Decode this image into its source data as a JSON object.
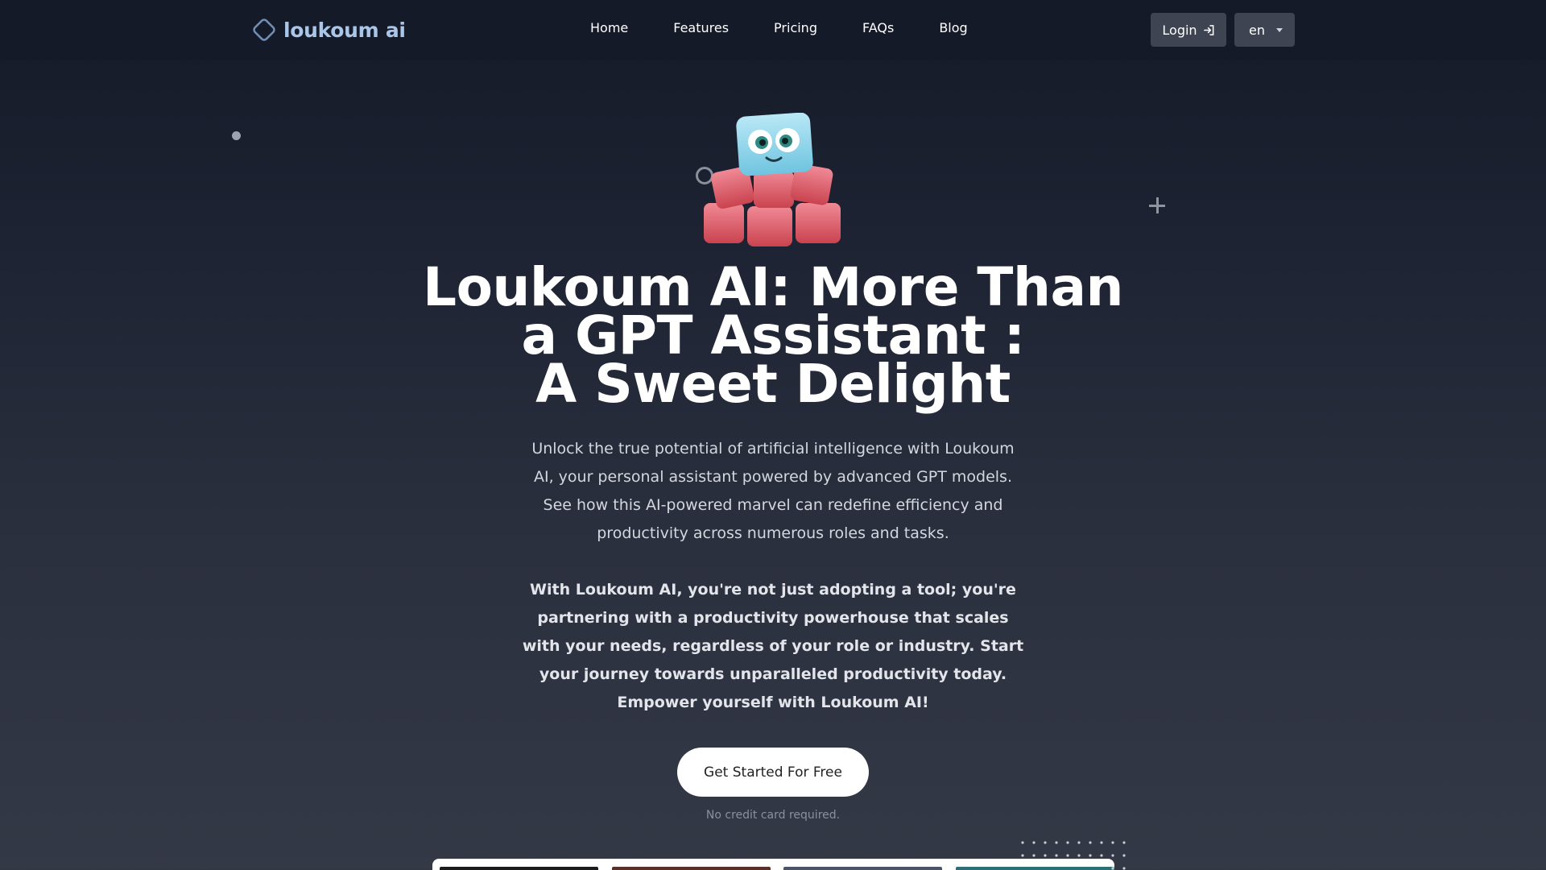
{
  "brand": {
    "name": "loukoum ai",
    "accent": "#a9c6e8",
    "mark_color": "#6f8fb5"
  },
  "nav": {
    "links": [
      "Home",
      "Features",
      "Pricing",
      "FAQs",
      "Blog"
    ],
    "login_label": "Login",
    "language": "en"
  },
  "hero": {
    "title_lines": [
      "Loukoum AI: More Than",
      "a GPT Assistant :",
      "A Sweet Delight"
    ],
    "description": "Unlock the true potential of artificial intelligence with Loukoum AI, your personal assistant powered by advanced GPT models. See how this AI-powered marvel can redefine efficiency and productivity across numerous roles and tasks.",
    "description_bold": "With Loukoum AI, you're not just adopting a tool; you're partnering with a productivity powerhouse that scales with your needs, regardless of your role or industry. Start your journey towards unparalleled productivity today. Empower yourself with Loukoum AI!",
    "cta_label": "Get Started For Free",
    "cta_note": "No credit card required."
  },
  "colors": {
    "background_top": "#151a28",
    "background_bottom": "#343946",
    "button_dark": "#3f4453",
    "cta_bg": "#ffffff"
  },
  "icons": {
    "logo": "diamond-outline-icon",
    "login": "sign-in-arrow-icon",
    "language_caret": "caret-down-icon",
    "mascot": "sugar-cube-robot-mascot",
    "decor_plus": "plus-icon",
    "decor_ring": "ring-icon",
    "decor_dot": "dot-icon"
  }
}
